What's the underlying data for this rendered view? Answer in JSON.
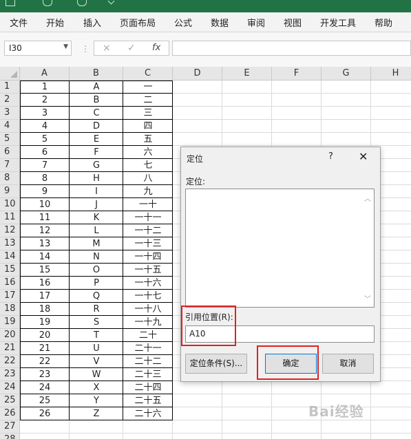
{
  "ribbon": {
    "tabs": [
      "文件",
      "开始",
      "插入",
      "页面布局",
      "公式",
      "数据",
      "审阅",
      "视图",
      "开发工具",
      "帮助"
    ]
  },
  "formula_bar": {
    "name_box": "I30",
    "fx_label": "fx",
    "cancel_icon": "×",
    "enter_icon": "✓",
    "value": ""
  },
  "sheet": {
    "columns": [
      "A",
      "B",
      "C",
      "D",
      "E",
      "F",
      "G",
      "H"
    ],
    "rows": [
      "1",
      "2",
      "3",
      "4",
      "5",
      "6",
      "7",
      "8",
      "9",
      "10",
      "11",
      "12",
      "13",
      "14",
      "15",
      "16",
      "17",
      "18",
      "19",
      "20",
      "21",
      "22",
      "23",
      "24",
      "25",
      "26",
      "27",
      "28"
    ],
    "col_a": [
      "1",
      "2",
      "3",
      "4",
      "5",
      "6",
      "7",
      "8",
      "9",
      "10",
      "11",
      "12",
      "13",
      "14",
      "15",
      "16",
      "17",
      "18",
      "19",
      "20",
      "21",
      "22",
      "23",
      "24",
      "25",
      "26"
    ],
    "col_b": [
      "A",
      "B",
      "C",
      "D",
      "E",
      "F",
      "G",
      "H",
      "I",
      "J",
      "K",
      "L",
      "M",
      "N",
      "O",
      "P",
      "Q",
      "R",
      "S",
      "T",
      "U",
      "V",
      "W",
      "X",
      "Y",
      "Z"
    ],
    "col_c": [
      "一",
      "二",
      "三",
      "四",
      "五",
      "六",
      "七",
      "八",
      "九",
      "一十",
      "一十一",
      "一十二",
      "一十三",
      "一十四",
      "一十五",
      "一十六",
      "一十七",
      "一十八",
      "一十九",
      "二十",
      "二十一",
      "二十二",
      "二十三",
      "二十四",
      "二十五",
      "二十六"
    ]
  },
  "dialog": {
    "title": "定位",
    "help": "?",
    "close": "✕",
    "goto_label": "定位:",
    "reference_label": "引用位置(R):",
    "reference_value": "A10",
    "special_button": "定位条件(S)...",
    "ok_button": "确定",
    "cancel_button": "取消"
  },
  "watermark": "Bai经验"
}
